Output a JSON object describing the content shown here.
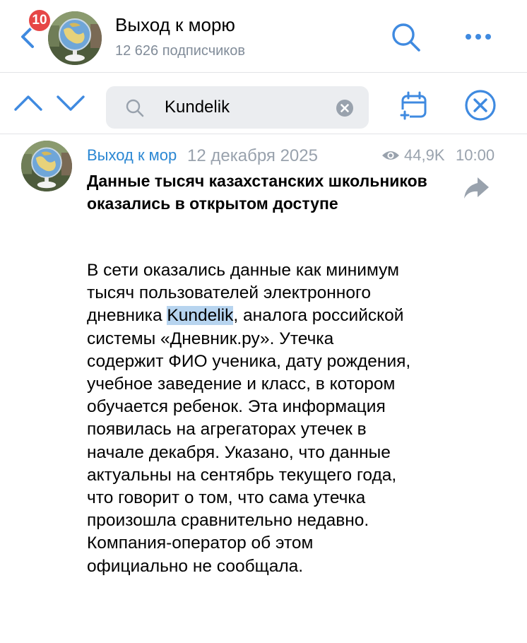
{
  "header": {
    "back_icon": "chevron-left-icon",
    "unread_badge": "10",
    "title": "Выход к морю",
    "subscribers": "12 626 подписчиков",
    "search_icon": "search-icon",
    "more_icon": "more-horizontal-icon"
  },
  "search": {
    "query": "Kundelik",
    "prev_icon": "chevron-up-icon",
    "next_icon": "chevron-down-icon",
    "clear_icon": "clear-icon",
    "calendar_icon": "calendar-icon",
    "close_icon": "close-circle-icon"
  },
  "post": {
    "author": "Выход к морю",
    "date": "12 декабря 2025",
    "views": "44,9K",
    "time": "10:00",
    "title": "Данные тысяч казахстанских школьников оказались в открытом доступе",
    "body_before": "В сети оказались данные как минимум тысяч пользователей электронного дневника ",
    "body_highlight": "Kundelik",
    "body_after": ", аналога российской системы «Дневник.ру». Утечка содержит ФИО ученика, дату рождения, учебное заведение и класс, в котором обучается ребенок. Эта информация появилась на агрегаторах утечек в начале декабря. Указано, что данные актуальны на сентябрь текущего года, что говорит о том, что сама утечка произошла сравнительно недавно. Компания-оператор об этом официально не сообщала.",
    "share_icon": "share-icon"
  },
  "colors": {
    "accent": "#2b87d3",
    "icon_blue": "#3f8ae0",
    "badge": "#e64646",
    "secondary_text": "#818c99",
    "highlight": "#b7d4ef"
  }
}
